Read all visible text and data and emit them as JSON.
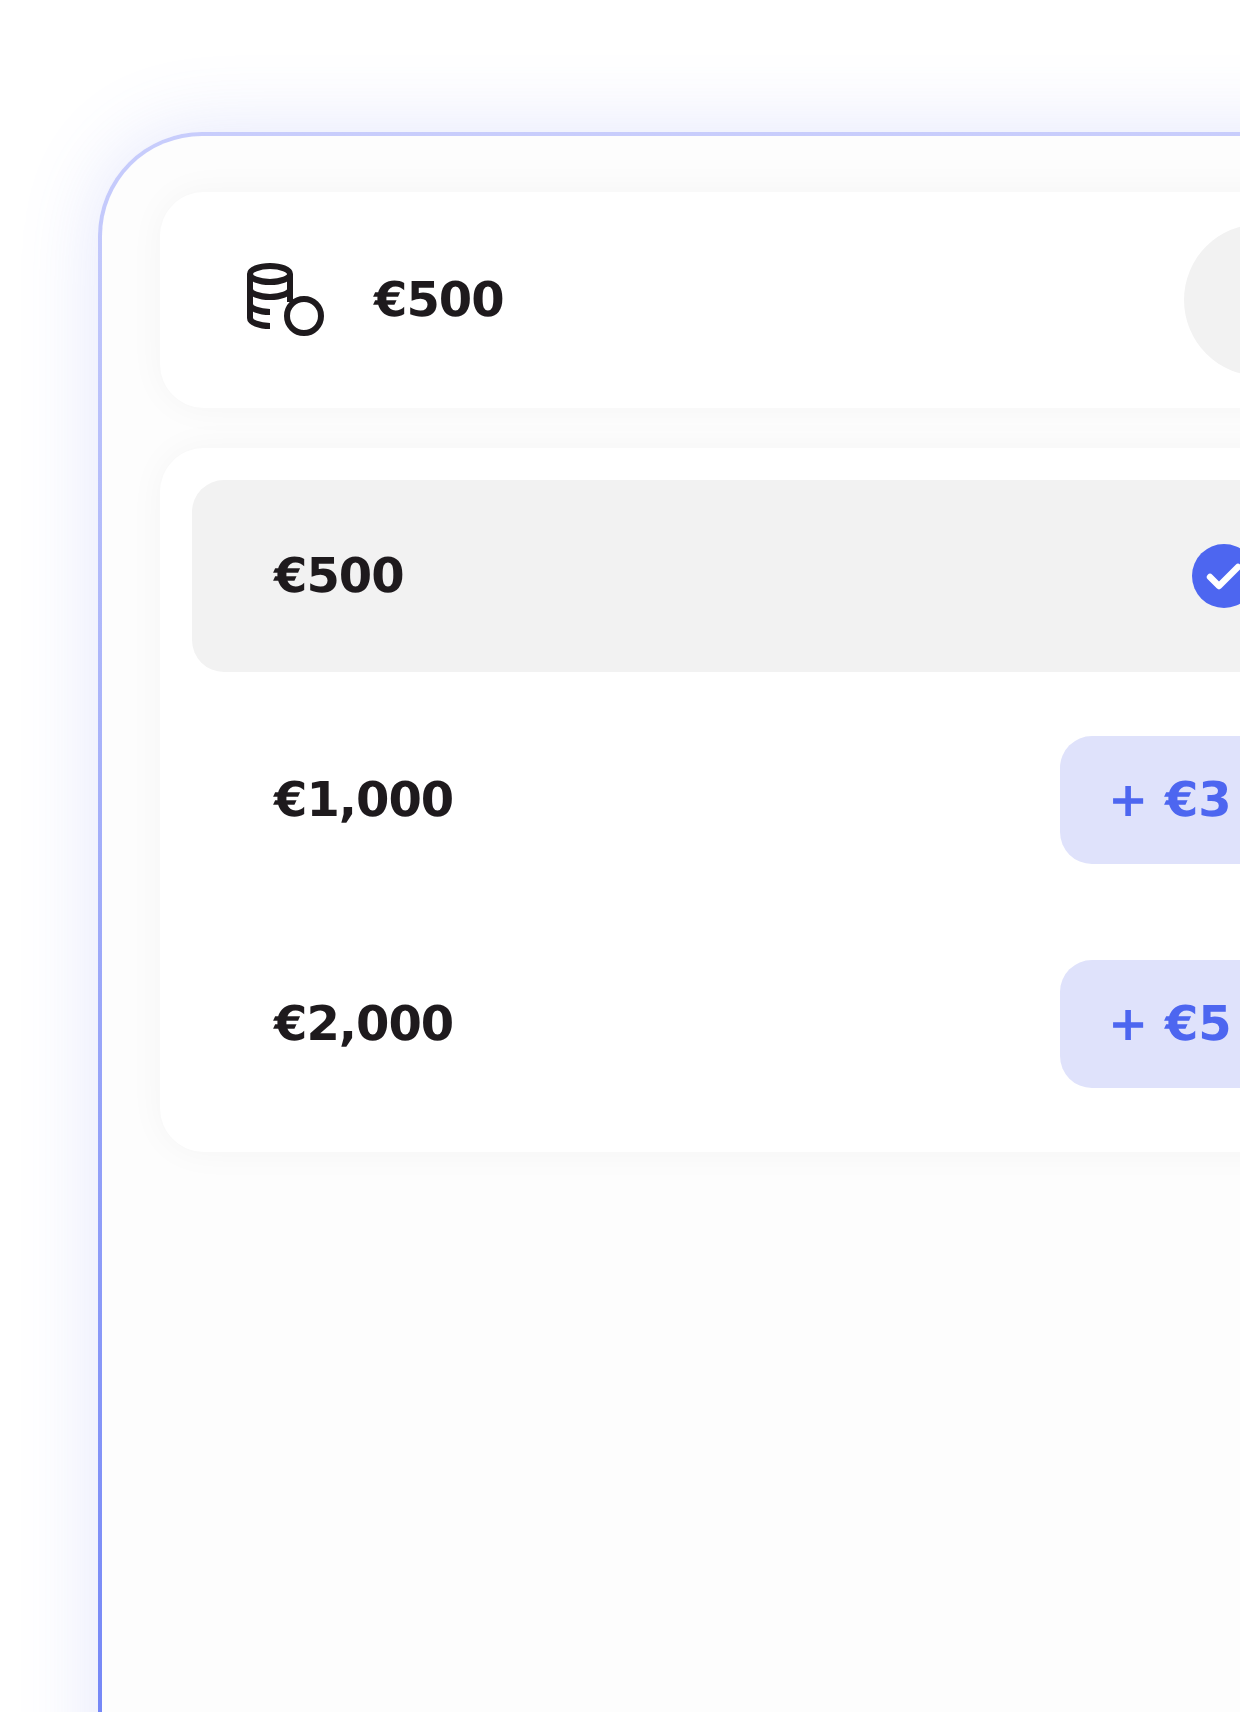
{
  "header": {
    "amount": "€500"
  },
  "options": [
    {
      "amount": "€500",
      "selected": true
    },
    {
      "amount": "€1,000",
      "selected": false,
      "surcharge": "+ €3"
    },
    {
      "amount": "€2,000",
      "selected": false,
      "surcharge": "+ €5"
    }
  ]
}
